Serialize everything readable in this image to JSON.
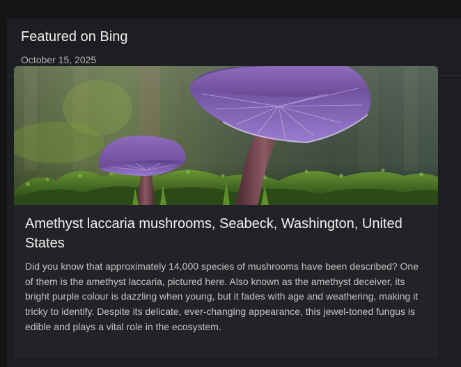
{
  "header": {
    "title": "Featured on Bing",
    "date": "October 15, 2025"
  },
  "card": {
    "image_subject": "purple-mushrooms-photo",
    "title": "Amethyst laccaria mushrooms, Seabeck, Washington, United States",
    "description": "Did you know that approximately 14,000 species of mushrooms have been described? One of them is the amethyst laccaria, pictured here. Also known as the amethyst deceiver, its bright purple colour is dazzling when young, but it fades with age and weathering, making it tricky to identify. Despite its delicate, ever-changing appearance, this jewel-toned fungus is edible and plays a vital role in the ecosystem."
  },
  "colors": {
    "background": "#141517",
    "panel": "#1d1e21",
    "card": "#222326",
    "mushroom_cap": "#7d5aa8",
    "moss": "#4f7a2a"
  }
}
